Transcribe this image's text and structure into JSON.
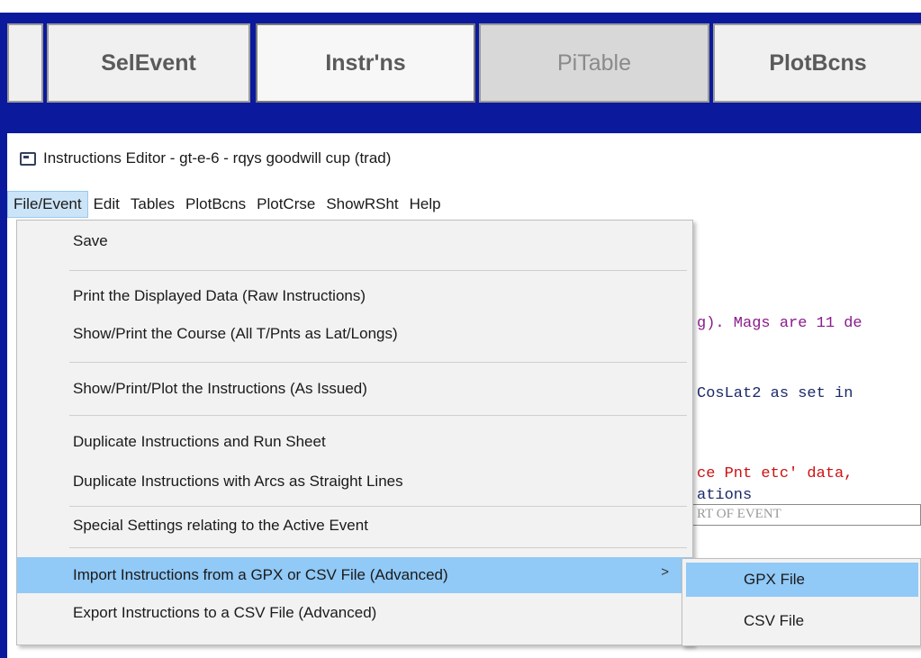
{
  "tabs": [
    {
      "label": ""
    },
    {
      "label": "SelEvent"
    },
    {
      "label": "Instr'ns"
    },
    {
      "label": "PiTable"
    },
    {
      "label": "PlotBcns"
    }
  ],
  "window": {
    "title": "Instructions Editor - gt-e-6 - rqys goodwill cup (trad)"
  },
  "menubar": {
    "items": [
      {
        "label": "File/Event"
      },
      {
        "label": "Edit"
      },
      {
        "label": "Tables"
      },
      {
        "label": "PlotBcns"
      },
      {
        "label": "PlotCrse"
      },
      {
        "label": "ShowRSht"
      },
      {
        "label": "Help"
      }
    ]
  },
  "file_menu": {
    "items": [
      {
        "label": "Save"
      },
      {
        "label": "Print the Displayed Data (Raw Instructions)"
      },
      {
        "label": "Show/Print the Course (All T/Pnts as Lat/Longs)"
      },
      {
        "label": "Show/Print/Plot the Instructions (As Issued)"
      },
      {
        "label": "Duplicate Instructions and Run Sheet"
      },
      {
        "label": "Duplicate Instructions with Arcs as Straight Lines"
      },
      {
        "label": "Special Settings relating to the Active Event"
      },
      {
        "label": "Import Instructions from a GPX or CSV File (Advanced)",
        "submenu_arrow": ">"
      },
      {
        "label": "Export Instructions to a CSV File (Advanced)"
      }
    ]
  },
  "import_submenu": {
    "items": [
      {
        "label": "GPX File"
      },
      {
        "label": "CSV File"
      }
    ]
  },
  "background_text": {
    "line1": "g). Mags are 11 de",
    "line2": "CosLat2 as set in",
    "line3": "ce Pnt etc' data, ",
    "line4": "ations",
    "line5": "RT OF EVENT"
  },
  "colors": {
    "header_blue": "#0b1a9c",
    "menu_highlight": "#91c9f7",
    "menubar_active": "#cce4f7"
  }
}
